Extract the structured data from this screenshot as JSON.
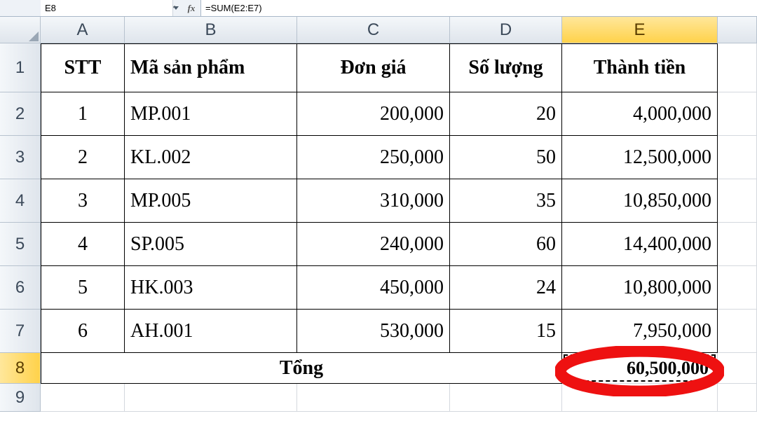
{
  "namebox": {
    "value": "E8"
  },
  "fx_label": "fx",
  "formula": "=SUM(E2:E7)",
  "columns": [
    "A",
    "B",
    "C",
    "D",
    "E"
  ],
  "row_numbers": [
    "1",
    "2",
    "3",
    "4",
    "5",
    "6",
    "7",
    "8",
    "9"
  ],
  "active_cell": "E8",
  "headers": {
    "stt": "STT",
    "ma": "Mã sản phẩm",
    "dongia": "Đơn giá",
    "soluong": "Số lượng",
    "thanhtien": "Thành tiền"
  },
  "rows": [
    {
      "stt": "1",
      "ma": "MP.001",
      "dongia": "200,000",
      "soluong": "20",
      "thanhtien": "4,000,000"
    },
    {
      "stt": "2",
      "ma": "KL.002",
      "dongia": "250,000",
      "soluong": "50",
      "thanhtien": "12,500,000"
    },
    {
      "stt": "3",
      "ma": "MP.005",
      "dongia": "310,000",
      "soluong": "35",
      "thanhtien": "10,850,000"
    },
    {
      "stt": "4",
      "ma": "SP.005",
      "dongia": "240,000",
      "soluong": "60",
      "thanhtien": "14,400,000"
    },
    {
      "stt": "5",
      "ma": "HK.003",
      "dongia": "450,000",
      "soluong": "24",
      "thanhtien": "10,800,000"
    },
    {
      "stt": "6",
      "ma": "AH.001",
      "dongia": "530,000",
      "soluong": "15",
      "thanhtien": "7,950,000"
    }
  ],
  "total_row": {
    "label": "Tổng",
    "value": "60,500,000"
  },
  "chart_data": {
    "type": "table",
    "columns": [
      "STT",
      "Mã sản phẩm",
      "Đơn giá",
      "Số lượng",
      "Thành tiền"
    ],
    "rows": [
      [
        1,
        "MP.001",
        200000,
        20,
        4000000
      ],
      [
        2,
        "KL.002",
        250000,
        50,
        12500000
      ],
      [
        3,
        "MP.005",
        310000,
        35,
        10850000
      ],
      [
        4,
        "SP.005",
        240000,
        60,
        14400000
      ],
      [
        5,
        "HK.003",
        450000,
        24,
        10800000
      ],
      [
        6,
        "AH.001",
        530000,
        15,
        7950000
      ]
    ],
    "total": 60500000
  }
}
